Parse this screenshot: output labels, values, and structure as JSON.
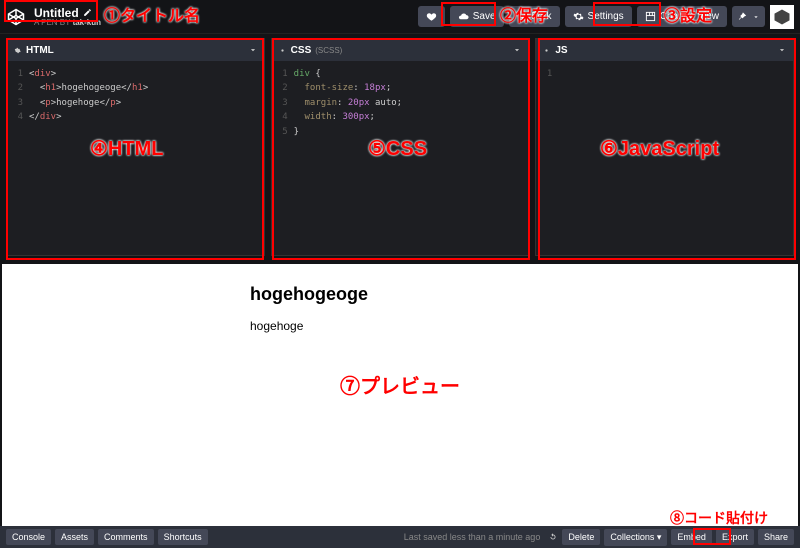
{
  "header": {
    "pen_title": "Untitled",
    "pen_by_prefix": "A PEN BY",
    "pen_author": "tak-kun",
    "love_label": "",
    "save_label": "Save",
    "fork_label": "Fork",
    "settings_label": "Settings",
    "changeview_label": "Change View"
  },
  "editors": {
    "html": {
      "title": "HTML",
      "lines": [
        {
          "n": "1",
          "html": "<div>"
        },
        {
          "n": "2",
          "html": "  <h1>hogehogeoge</h1>"
        },
        {
          "n": "3",
          "html": "  <p>hogehoge</p>"
        },
        {
          "n": "4",
          "html": "</div>"
        }
      ]
    },
    "css": {
      "title": "CSS",
      "sub": "(SCSS)",
      "lines": [
        {
          "n": "1",
          "raw": "div {"
        },
        {
          "n": "2",
          "raw": "  font-size: 18px;"
        },
        {
          "n": "3",
          "raw": "  margin: 20px auto;"
        },
        {
          "n": "4",
          "raw": "  width: 300px;"
        },
        {
          "n": "5",
          "raw": "}"
        }
      ]
    },
    "js": {
      "title": "JS"
    }
  },
  "preview": {
    "h1": "hogehogeoge",
    "p": "hogehoge"
  },
  "footer": {
    "console": "Console",
    "assets": "Assets",
    "comments": "Comments",
    "shortcuts": "Shortcuts",
    "status": "Last saved less than a minute ago",
    "delete": "Delete",
    "collections": "Collections",
    "embed": "Embed",
    "export": "Export",
    "share": "Share"
  },
  "annotations": {
    "a1": "①タイトル名",
    "a2": "②保存",
    "a3": "③設定",
    "a4": "④HTML",
    "a5": "⑤CSS",
    "a6": "⑥JavaScript",
    "a7": "⑦プレビュー",
    "a8": "⑧コード貼付け"
  }
}
